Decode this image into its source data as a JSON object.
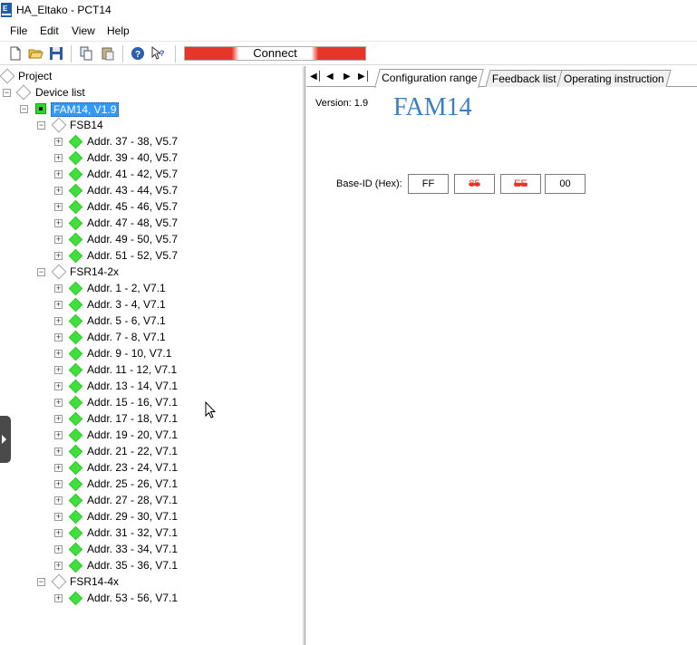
{
  "window": {
    "title": "HA_Eltako - PCT14"
  },
  "menu": [
    "File",
    "Edit",
    "View",
    "Help"
  ],
  "toolbar": {
    "connect_label": "Connect",
    "icons": [
      "new-file-icon",
      "open-folder-icon",
      "save-icon",
      "copy-icon",
      "paste-icon",
      "help-icon",
      "context-help-icon"
    ]
  },
  "tree": {
    "project": "Project",
    "device_list": "Device list",
    "root_device": "FAM14, V1.9",
    "groups": [
      {
        "name": "FSB14",
        "items": [
          "Addr. 37 - 38, V5.7",
          "Addr. 39 - 40, V5.7",
          "Addr. 41 - 42, V5.7",
          "Addr. 43 - 44, V5.7",
          "Addr. 45 - 46, V5.7",
          "Addr. 47 - 48, V5.7",
          "Addr. 49 - 50, V5.7",
          "Addr. 51 - 52, V5.7"
        ]
      },
      {
        "name": "FSR14-2x",
        "items": [
          "Addr. 1 - 2, V7.1",
          "Addr. 3 - 4, V7.1",
          "Addr. 5 - 6, V7.1",
          "Addr. 7 - 8, V7.1",
          "Addr. 9 - 10, V7.1",
          "Addr. 11 - 12, V7.1",
          "Addr. 13 - 14, V7.1",
          "Addr. 15 - 16, V7.1",
          "Addr. 17 - 18, V7.1",
          "Addr. 19 - 20, V7.1",
          "Addr. 21 - 22, V7.1",
          "Addr. 23 - 24, V7.1",
          "Addr. 25 - 26, V7.1",
          "Addr. 27 - 28, V7.1",
          "Addr. 29 - 30, V7.1",
          "Addr. 31 - 32, V7.1",
          "Addr. 33 - 34, V7.1",
          "Addr. 35 - 36, V7.1"
        ]
      },
      {
        "name": "FSR14-4x",
        "items": [
          "Addr. 53 - 56, V7.1"
        ]
      }
    ]
  },
  "tabs": [
    "Configuration range",
    "Feedback list",
    "Operating instruction"
  ],
  "active_tab": "Configuration range",
  "config": {
    "version_label": "Version: 1.9",
    "device_title": "FAM14",
    "base_id_label": "Base-ID (Hex):",
    "base_id": [
      "FF",
      "85",
      "EE",
      "00"
    ],
    "redacted_bytes": [
      1,
      2
    ]
  },
  "colors": {
    "accent_blue": "#3a7fc1",
    "selection": "#3399ff",
    "connect_red": "#e8352a",
    "node_green": "#3ee03a"
  }
}
